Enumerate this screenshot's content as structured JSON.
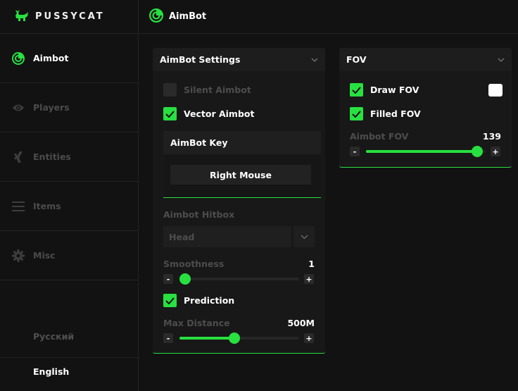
{
  "app": {
    "brand": "PUSSYCAT",
    "accent": "#28e040",
    "brand_icon": "cat-icon"
  },
  "header": {
    "title": "AimBot",
    "icon": "radar-icon"
  },
  "sidebar": {
    "items": [
      {
        "label": "Aimbot",
        "icon": "radar-icon",
        "active": true
      },
      {
        "label": "Players",
        "icon": "eye-icon",
        "active": false
      },
      {
        "label": "Entities",
        "icon": "xing-icon",
        "active": false
      },
      {
        "label": "Items",
        "icon": "menu-icon",
        "active": false
      },
      {
        "label": "Misc",
        "icon": "gear-icon",
        "active": false
      }
    ],
    "languages": [
      "Русский",
      "English"
    ],
    "selected_language": "English"
  },
  "aimbot_settings": {
    "title": "AimBot Settings",
    "silent_aimbot": {
      "label": "Silent Aimbot",
      "checked": false
    },
    "vector_aimbot": {
      "label": "Vector Aimbot",
      "checked": true
    },
    "aimbot_key": {
      "title": "AimBot Key",
      "value": "Right Mouse"
    },
    "hitbox": {
      "label": "Aimbot Hitbox",
      "value": "Head"
    },
    "smoothness": {
      "label": "Smoothness",
      "value": "1",
      "fraction": 0.0
    },
    "prediction": {
      "label": "Prediction",
      "checked": true
    },
    "max_distance": {
      "label": "Max Distance",
      "value": "500M",
      "fraction": 0.46
    },
    "minus": "-",
    "plus": "+"
  },
  "fov": {
    "title": "FOV",
    "draw_fov": {
      "label": "Draw FOV",
      "checked": true,
      "color": "#ffffff"
    },
    "filled_fov": {
      "label": "Filled FOV",
      "checked": true
    },
    "aimbot_fov": {
      "label": "Aimbot FOV",
      "value": "139",
      "fraction": 0.93
    },
    "minus": "-",
    "plus": "+"
  }
}
